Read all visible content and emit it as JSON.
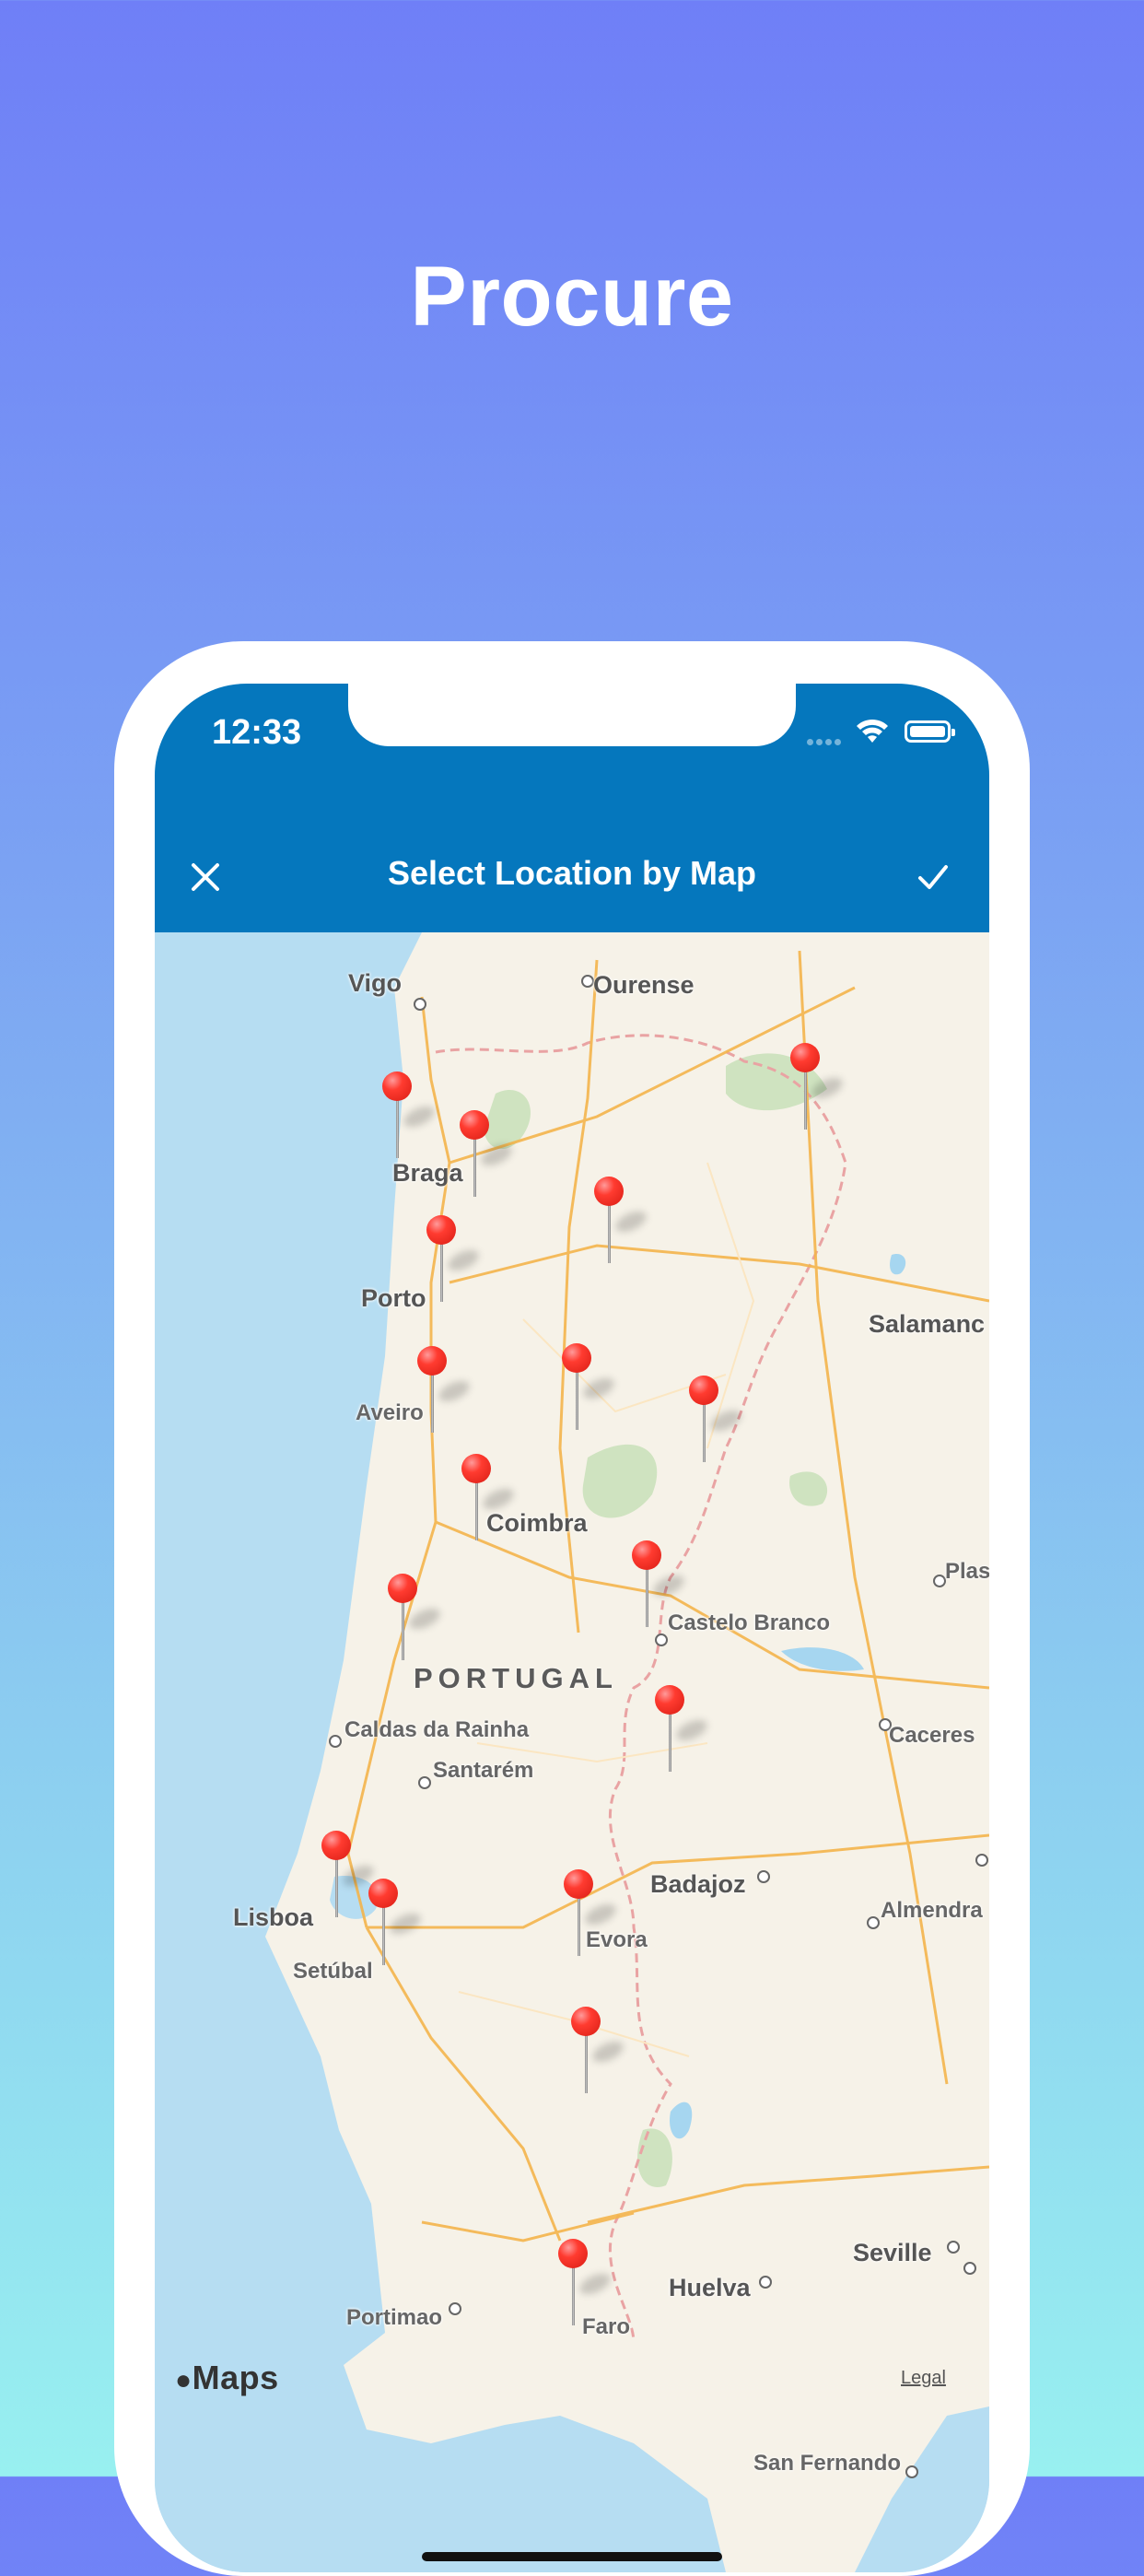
{
  "headline": "Procure",
  "status": {
    "time": "12:33"
  },
  "navbar": {
    "title": "Select Location by Map"
  },
  "map": {
    "attribution": "Maps",
    "legal": "Legal",
    "country": "PORTUGAL",
    "cities": [
      {
        "name": "Vigo"
      },
      {
        "name": "Ourense"
      },
      {
        "name": "Braga"
      },
      {
        "name": "Porto"
      },
      {
        "name": "Salamanc"
      },
      {
        "name": "Aveiro"
      },
      {
        "name": "Coimbra"
      },
      {
        "name": "Plas"
      },
      {
        "name": "Castelo Branco"
      },
      {
        "name": "Caldas da Rainha"
      },
      {
        "name": "Caceres"
      },
      {
        "name": "Santarém"
      },
      {
        "name": "Badajoz"
      },
      {
        "name": "Lisboa"
      },
      {
        "name": "Almendra"
      },
      {
        "name": "Setúbal"
      },
      {
        "name": "Evora"
      },
      {
        "name": "Seville"
      },
      {
        "name": "Huelva"
      },
      {
        "name": "Portimao"
      },
      {
        "name": "Faro"
      },
      {
        "name": "San Fernando"
      }
    ],
    "pin_count": 18
  },
  "colors": {
    "navbar": "#0577bd",
    "pin": "#ff3b30",
    "land": "#f6f2e8",
    "sea": "#b6ddf2"
  },
  "icons": {
    "close": "close-icon",
    "confirm": "checkmark-icon",
    "wifi": "wifi-icon",
    "battery": "battery-icon"
  }
}
